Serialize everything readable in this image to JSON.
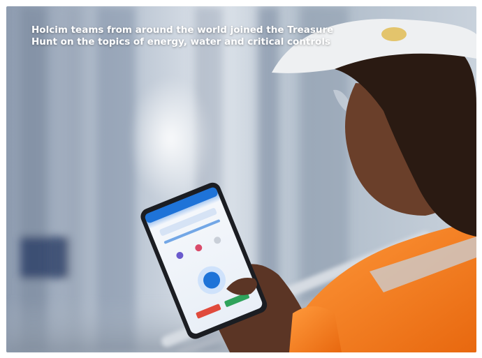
{
  "caption": "Holcim teams from around the world joined the Treasure Hunt on the topics of energy, water and critical controls",
  "colors": {
    "safety_vest": "#f47b20",
    "helmet": "#eef0f2",
    "app_blue": "#1e73d8",
    "background": "#a9b6c7"
  },
  "icon_names": [
    "worker-photo",
    "smartphone-icon",
    "app-screen"
  ]
}
